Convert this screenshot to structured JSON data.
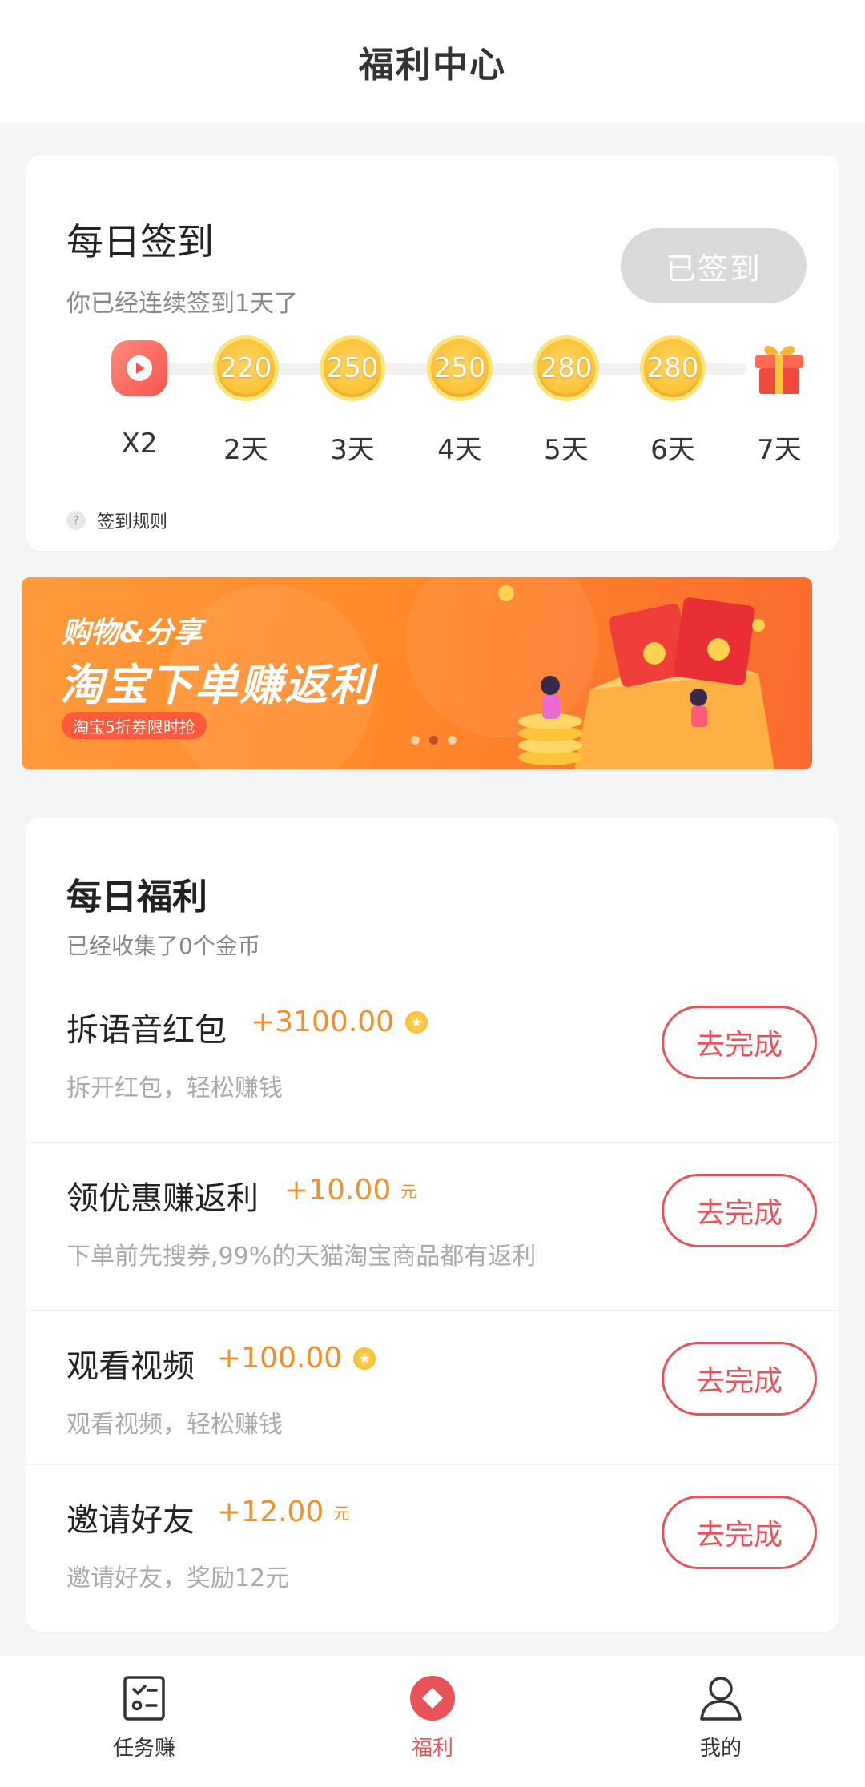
{
  "header": {
    "title": "福利中心"
  },
  "signin": {
    "title": "每日签到",
    "subtitle": "你已经连续签到1天了",
    "button_label": "已签到",
    "days": [
      {
        "reward": "",
        "label": "X2",
        "icon": "video-play-icon"
      },
      {
        "reward": "220",
        "label": "2天",
        "icon": "coin-icon"
      },
      {
        "reward": "250",
        "label": "3天",
        "icon": "coin-icon"
      },
      {
        "reward": "250",
        "label": "4天",
        "icon": "coin-icon"
      },
      {
        "reward": "280",
        "label": "5天",
        "icon": "coin-icon"
      },
      {
        "reward": "280",
        "label": "6天",
        "icon": "coin-icon"
      },
      {
        "reward": "",
        "label": "7天",
        "icon": "gift-icon"
      }
    ],
    "rules_label": "签到规则"
  },
  "banner": {
    "line1": "购物&分享",
    "line2": "淘宝下单赚返利",
    "tag": "淘宝5折券限时抢",
    "dots": 3,
    "active_dot": 1
  },
  "welfare": {
    "title": "每日福利",
    "subtitle": "已经收集了0个金币",
    "tasks": [
      {
        "name": "拆语音红包",
        "reward": "+3100.00",
        "unit_type": "coin",
        "desc": "拆开红包，轻松赚钱",
        "button": "去完成"
      },
      {
        "name": "领优惠赚返利",
        "reward": "+10.00",
        "unit_type": "yuan",
        "unit": "元",
        "desc": "下单前先搜券,99%的天猫淘宝商品都有返利",
        "button": "去完成"
      },
      {
        "name": "观看视频",
        "reward": "+100.00",
        "unit_type": "coin",
        "desc": "观看视频，轻松赚钱",
        "button": "去完成"
      },
      {
        "name": "邀请好友",
        "reward": "+12.00",
        "unit_type": "yuan",
        "unit": "元",
        "desc": "邀请好友，奖励12元",
        "button": "去完成"
      }
    ]
  },
  "tabbar": {
    "items": [
      {
        "label": "任务赚",
        "icon": "task-checklist-icon",
        "active": false
      },
      {
        "label": "福利",
        "icon": "welfare-diamond-icon",
        "active": true
      },
      {
        "label": "我的",
        "icon": "user-profile-icon",
        "active": false
      }
    ]
  },
  "colors": {
    "accent": "#e8535a",
    "reward": "#f0902d",
    "coin": "#fbc43b",
    "signed_button": "#d9d9d9"
  }
}
